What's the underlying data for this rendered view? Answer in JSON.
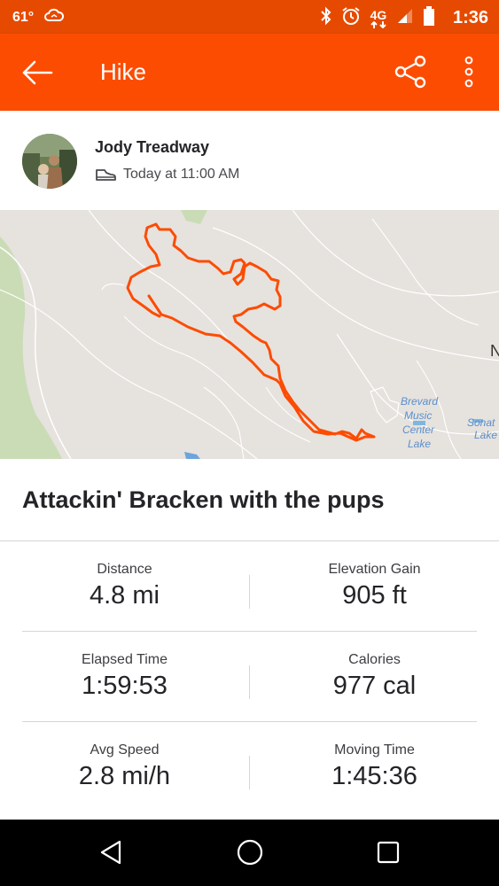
{
  "status_bar": {
    "temperature": "61°",
    "network": "4G",
    "time": "1:36",
    "icons": [
      "cloud-icon",
      "bluetooth-icon",
      "alarm-icon",
      "network-4g-icon",
      "signal-icon",
      "battery-icon"
    ]
  },
  "app_bar": {
    "title": "Hike",
    "icons": [
      "back-arrow-icon",
      "share-icon",
      "more-vert-icon"
    ]
  },
  "athlete": {
    "name": "Jody Treadway",
    "activity_time": "Today at 11:00 AM",
    "activity_icon": "hiking-shoe-icon"
  },
  "map": {
    "labels": {
      "brevard": "Brevard",
      "music": "Music",
      "center": "Center",
      "lake": "Lake",
      "sonat": "Sonat",
      "sonat_lake": "Lake",
      "edge": "N"
    },
    "route_color": "#fc4c02"
  },
  "activity": {
    "title": "Attackin' Bracken with the pups"
  },
  "stats": [
    {
      "left": {
        "label": "Distance",
        "value": "4.8 mi"
      },
      "right": {
        "label": "Elevation Gain",
        "value": "905 ft"
      }
    },
    {
      "left": {
        "label": "Elapsed Time",
        "value": "1:59:53"
      },
      "right": {
        "label": "Calories",
        "value": "977 cal"
      }
    },
    {
      "left": {
        "label": "Avg Speed",
        "value": "2.8 mi/h"
      },
      "right": {
        "label": "Moving Time",
        "value": "1:45:36"
      }
    }
  ],
  "nav": {
    "icons": [
      "nav-back-icon",
      "nav-home-icon",
      "nav-recents-icon"
    ]
  },
  "colors": {
    "brand": "#fc4c02",
    "status_bar": "#e64a00",
    "text": "#242428"
  }
}
